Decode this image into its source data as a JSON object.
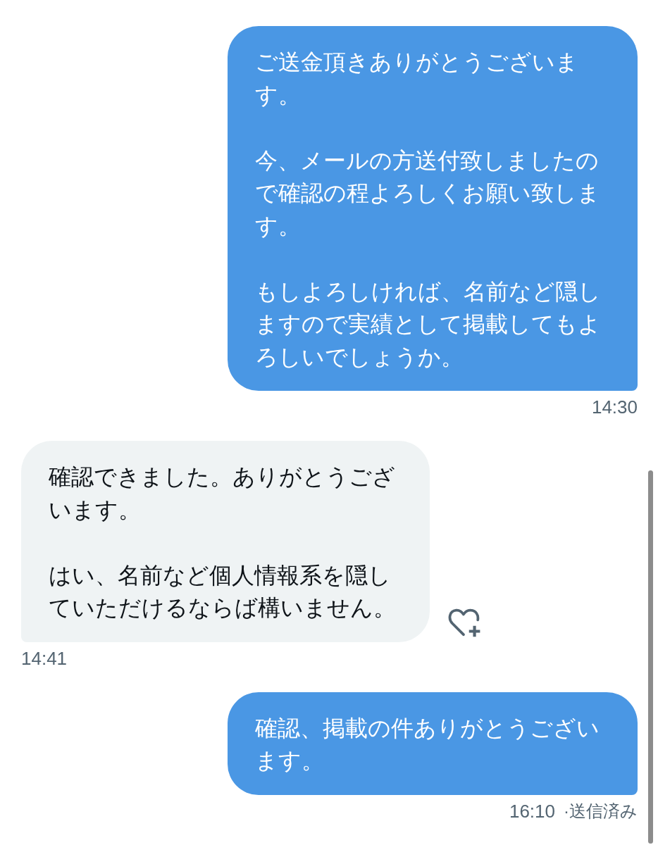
{
  "messages": [
    {
      "kind": "sent",
      "paragraphs": [
        "ご送金頂きありがとうございます。",
        "今、メールの方送付致しましたので確認の程よろしくお願い致します。",
        "もしよろしければ、名前など隠しますので実績として掲載してもよろしいでしょうか。"
      ],
      "time": "14:30"
    },
    {
      "kind": "received",
      "paragraphs": [
        "確認できました。ありがとうございます。",
        "はい、名前など個人情報系を隠していただけるならば構いません。"
      ],
      "time": "14:41"
    },
    {
      "kind": "sent",
      "paragraphs": [
        "確認、掲載の件ありがとうございます。"
      ],
      "time": "16:10",
      "status": "·送信済み"
    }
  ]
}
